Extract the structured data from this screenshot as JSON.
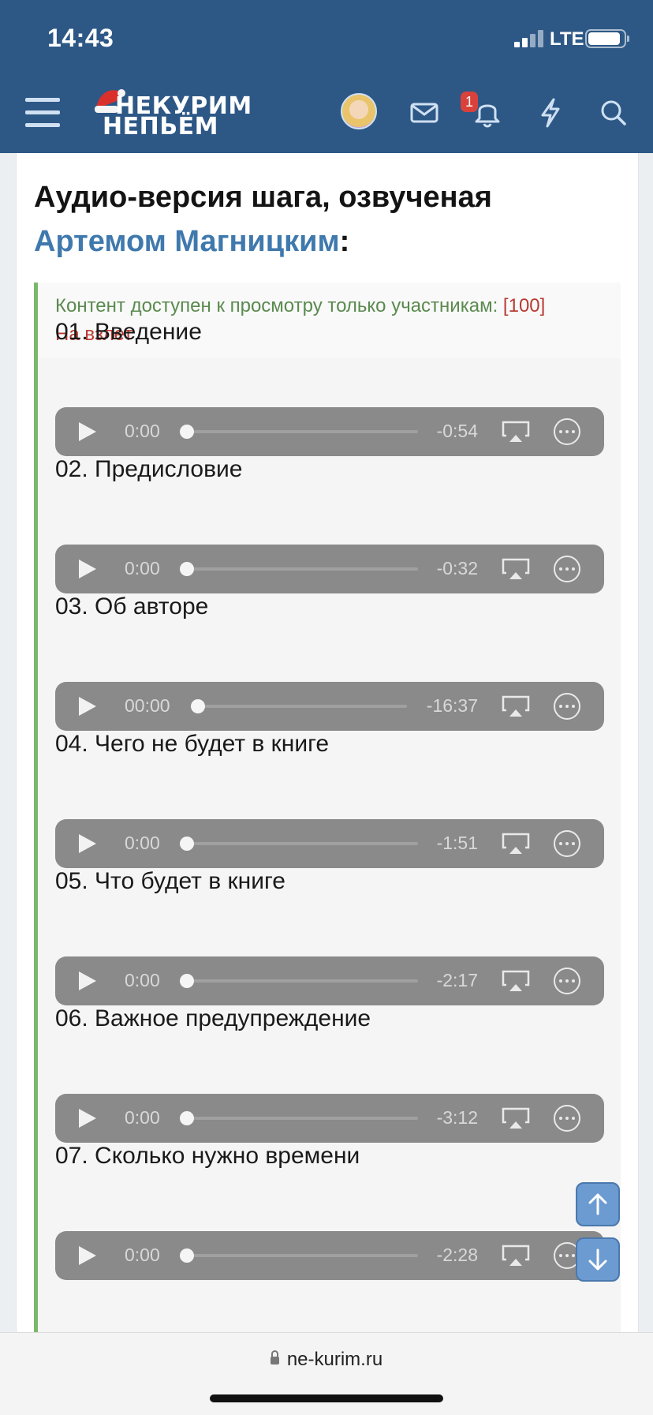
{
  "status_bar": {
    "time": "14:43",
    "network": "LTE"
  },
  "header": {
    "logo_line1": "НЕКУРИМ",
    "logo_line2": "НЕПЬЁМ",
    "notification_count": "1",
    "brand_color": "#2d5886"
  },
  "post": {
    "heading_text": "Аудио-версия шага, озвученая",
    "heading_author": "Артемом Магницким",
    "heading_colon": ":"
  },
  "locked_notice": {
    "text": "Контент доступен к просмотру только участникам:",
    "group_part1": "[100]",
    "group_part2": "На взлет"
  },
  "tracks": [
    {
      "title": "01. Введение",
      "current": "0:00",
      "remaining": "-0:54"
    },
    {
      "title": "02. Предисловие",
      "current": "0:00",
      "remaining": "-0:32"
    },
    {
      "title": "03. Об авторе",
      "current": "00:00",
      "remaining": "-16:37"
    },
    {
      "title": "04. Чего не будет в книге",
      "current": "0:00",
      "remaining": "-1:51"
    },
    {
      "title": "05. Что будет в книге",
      "current": "0:00",
      "remaining": "-2:17"
    },
    {
      "title": "06. Важное предупреждение",
      "current": "0:00",
      "remaining": "-3:12"
    },
    {
      "title": "07. Сколько нужно времени",
      "current": "0:00",
      "remaining": "-2:28"
    }
  ],
  "browser": {
    "url": "ne-kurim.ru"
  }
}
